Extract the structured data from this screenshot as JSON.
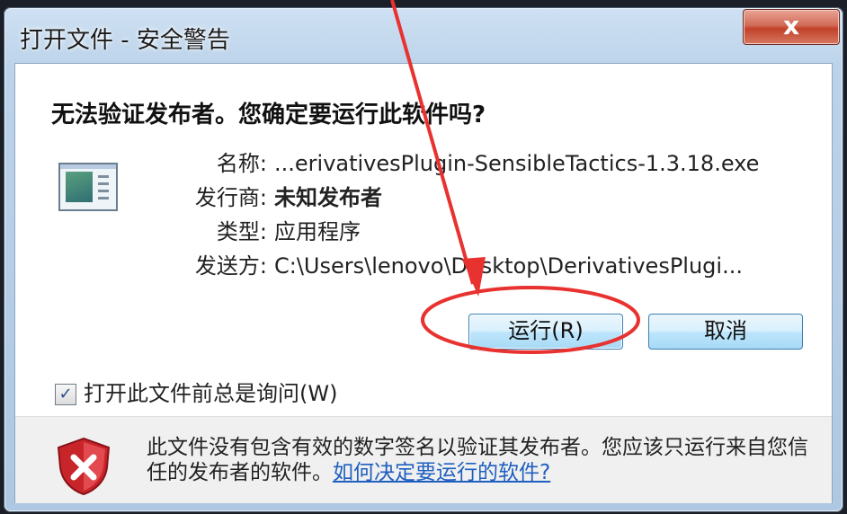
{
  "window": {
    "title": "打开文件 - 安全警告",
    "close_label": "x"
  },
  "heading": "无法验证发布者。您确定要运行此软件吗?",
  "details": {
    "labels": [
      "名称:",
      "发行商:",
      "类型:",
      "发送方:"
    ],
    "name": "...erivativesPlugin-SensibleTactics-1.3.18.exe",
    "publisher": "未知发布者",
    "type": "应用程序",
    "from": "C:\\Users\\lenovo\\Desktop\\DerivativesPlugi..."
  },
  "buttons": {
    "run": "运行(R)",
    "cancel": "取消"
  },
  "checkbox": {
    "checked": true,
    "label": "打开此文件前总是询问(W)"
  },
  "warning": {
    "text": "此文件没有包含有效的数字签名以验证其发布者。您应该只运行来自您信任的发布者的软件。",
    "link": "如何决定要运行的软件?"
  },
  "colors": {
    "annotation_red": "#e8322f",
    "link_blue": "#1f5fbf",
    "shield_red": "#c8252b"
  },
  "icons": [
    "application-icon",
    "security-shield-icon",
    "checkmark-icon",
    "close-icon"
  ]
}
